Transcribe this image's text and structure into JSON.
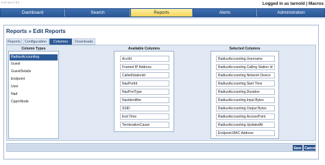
{
  "app": {
    "brand": "networks",
    "login_status": "Logged in as tarnold | Macros"
  },
  "nav": {
    "tabs": [
      {
        "label": "Dashboard"
      },
      {
        "label": "Search"
      },
      {
        "label": "Reports"
      },
      {
        "label": "Alerts"
      },
      {
        "label": "Administration"
      }
    ],
    "active": "Reports"
  },
  "page": {
    "title": "Reports » Edit Reports",
    "subtabs": [
      "Reports",
      "Configuration",
      "Columns",
      "Downloads"
    ],
    "active_subtab": "Columns"
  },
  "column_types": {
    "header": "Column Types",
    "items": [
      "RadiusAccounting",
      "Guest",
      "GuestDetails",
      "Endpoint",
      "User",
      "Nad",
      "CppmNode"
    ],
    "selected": "RadiusAccounting"
  },
  "available_columns": {
    "header": "Available Columns",
    "items": [
      "AcctId",
      "Framed IP Address",
      "CalledStationId",
      "NasPortId",
      "NasPortType",
      "NasIdentifier",
      "SSID",
      "End Time",
      "TerminationCause"
    ]
  },
  "selected_columns": {
    "header": "Selected Columns",
    "items": [
      "RadiusAccounting.Username",
      "RadiusAccounting.Calling Station Id",
      "RadiusAccounting.Network Device",
      "RadiusAccounting.Start Time",
      "RadiusAccounting.Duration",
      "RadiusAccounting.Input Bytes",
      "RadiusAccounting.Output Bytes",
      "RadiusAccounting.AccessPoint",
      "RadiusAccounting.UpdatedAt",
      "Endpoint.MAC Address"
    ]
  },
  "actions": {
    "save_label": "Save",
    "cancel_label": "Cancel"
  }
}
